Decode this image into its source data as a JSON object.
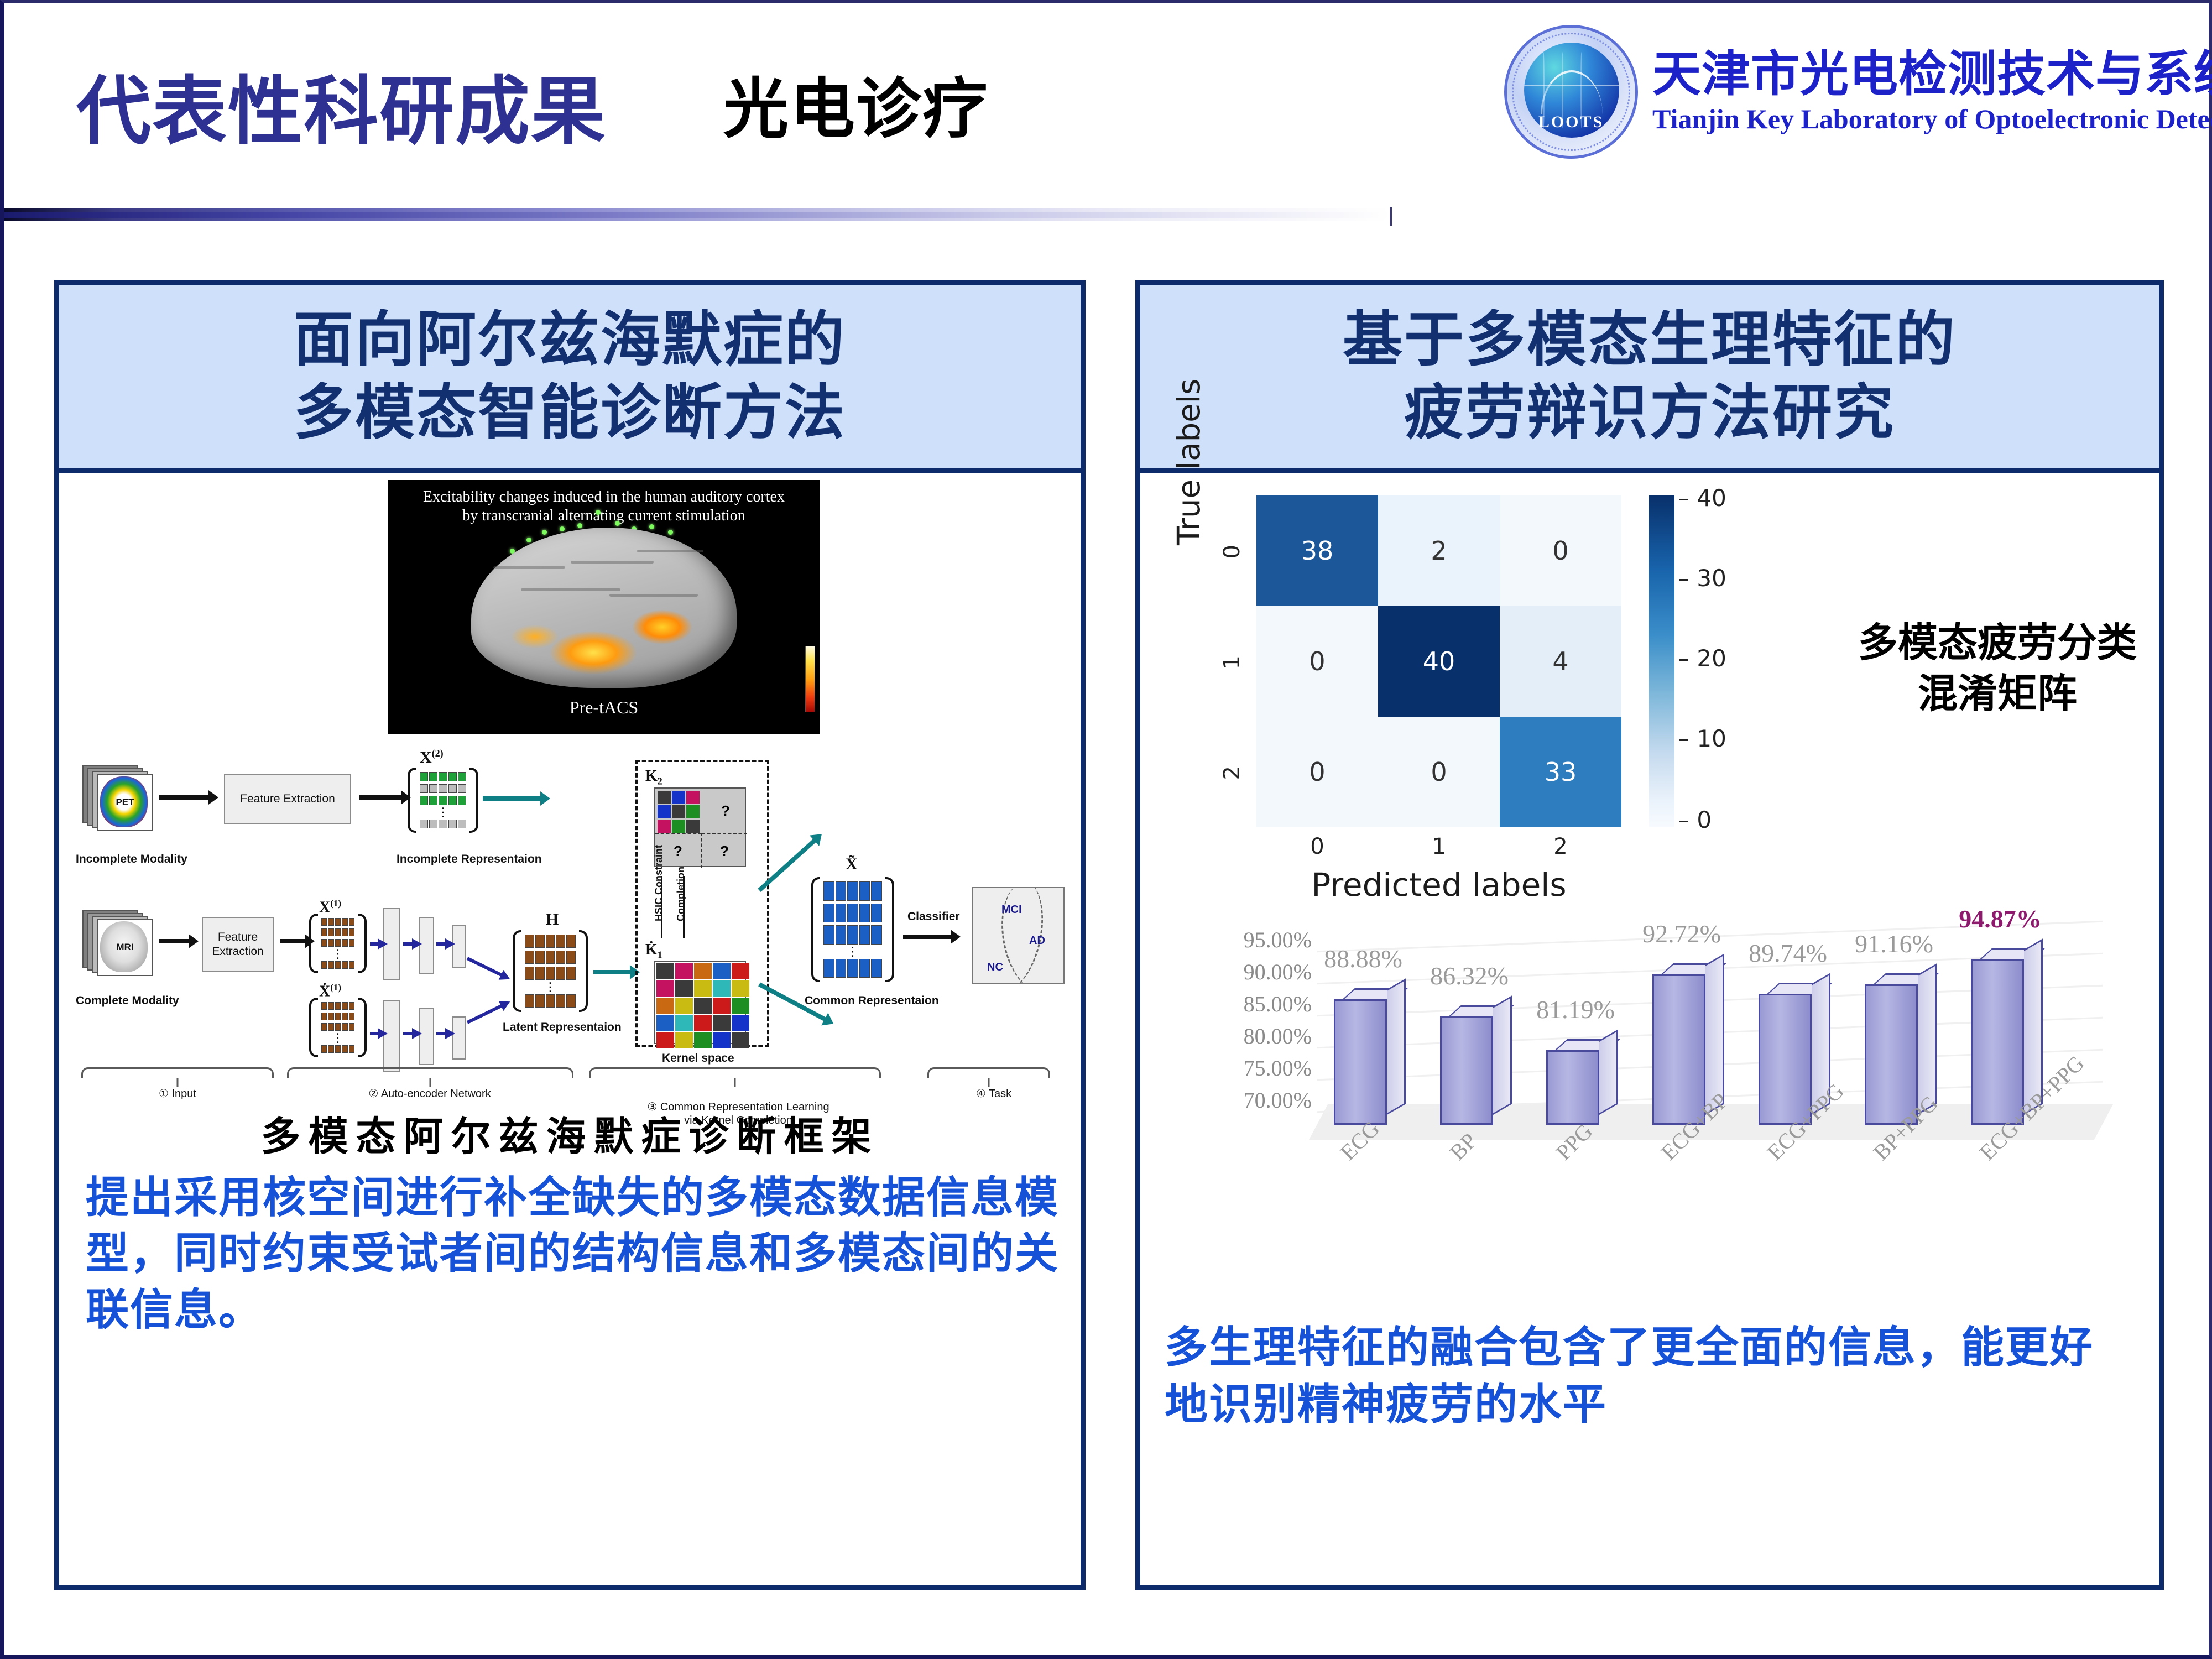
{
  "header": {
    "title": "代表性科研成果",
    "subtitle": "光电诊疗",
    "logo": {
      "badge_text": "LOOTS",
      "cn_name": "天津市光电检测技术与系统重点实验室",
      "en_name": "Tianjin Key Laboratory of Optoelectronic Detection and System"
    },
    "title_color": "#2e3192",
    "subtitle_color": "#000000",
    "logo_color": "#1d22c8"
  },
  "left_panel": {
    "title_line1": "面向阿尔兹海默症的",
    "title_line2": "多模态智能诊断方法",
    "brain_figure": {
      "caption_line1": "Excitability changes induced in the human auditory cortex",
      "caption_line2": "by transcranial alternating current stimulation",
      "label": "Pre-tACS"
    },
    "framework": {
      "incomplete_modality": "Incomplete Modality",
      "complete_modality": "Complete Modality",
      "feature_extraction_1": "Feature Extraction",
      "feature_extraction_2": "Feature Extraction",
      "pet_label": "PET",
      "mri_label": "MRI",
      "x2_symbol": "X",
      "x2_sup": "(2)",
      "x1_symbol": "X",
      "x1_sup": "(1)",
      "xdot_symbol": "Ẋ",
      "xdot_sup": "(1)",
      "h_symbol": "H",
      "xtilde_symbol": "X̃",
      "incomplete_representation": "Incomplete Representaion",
      "latent_representation": "Latent Representaion",
      "common_representation": "Common Representaion",
      "kernel_space": "Kernel space",
      "k2_symbol": "K",
      "k2_sub": "2",
      "k1_symbol": "K̇",
      "k1_sub": "1",
      "question_mark": "?",
      "hsic_constraint": "HSIC Constraint",
      "completion": "Completion",
      "classifier": "Classifier",
      "class_mci": "MCI",
      "class_ad": "AD",
      "class_nc": "NC",
      "stages": [
        {
          "num": "①",
          "label": "Input"
        },
        {
          "num": "②",
          "label": "Auto-encoder Network"
        },
        {
          "num": "③",
          "label": "Common Representation Learning\nvia Kernel Completion"
        },
        {
          "num": "④",
          "label": "Task"
        }
      ]
    },
    "framework_title": "多模态阿尔兹海默症诊断框架",
    "description": "提出采用核空间进行补全缺失的多模态数据信息模型，同时约束受试者间的结构信息和多模态间的关联信息。",
    "description_color": "#1652d8"
  },
  "right_panel": {
    "title_line1": "基于多模态生理特征的",
    "title_line2": "疲劳辩识方法研究",
    "note_line1": "多模态疲劳分类",
    "note_line2": "混淆矩阵",
    "description": "多生理特征的融合包含了更全面的信息，能更好地识别精神疲劳的水平",
    "description_color": "#1652d8"
  },
  "chart_data": [
    {
      "type": "heatmap",
      "title": "",
      "xlabel": "Predicted labels",
      "ylabel": "True labels",
      "xticks": [
        "0",
        "1",
        "2"
      ],
      "yticks": [
        "0",
        "1",
        "2"
      ],
      "matrix": [
        [
          38,
          2,
          0
        ],
        [
          0,
          40,
          4
        ],
        [
          0,
          0,
          33
        ]
      ],
      "colorbar": {
        "ticks": [
          0,
          10,
          20,
          30,
          40
        ],
        "vmin": 0,
        "vmax": 40,
        "cmap": "Blues"
      },
      "cell_colors": [
        [
          "#1b5799",
          "#eaf2fb",
          "#f3f8fd"
        ],
        [
          "#f3f8fd",
          "#08306b",
          "#e3eef9"
        ],
        [
          "#f3f8fd",
          "#f3f8fd",
          "#2d7dbf"
        ]
      ],
      "cell_text_colors": [
        [
          "#ffffff",
          "#333333",
          "#333333"
        ],
        [
          "#333333",
          "#ffffff",
          "#333333"
        ],
        [
          "#333333",
          "#333333",
          "#ffffff"
        ]
      ]
    },
    {
      "type": "bar",
      "title": "",
      "xlabel": "",
      "ylabel": "",
      "categories": [
        "ECG",
        "BP",
        "PPG",
        "ECG+BP",
        "ECG+PPG",
        "BP+PPG",
        "ECG+BP+PPG"
      ],
      "values": [
        88.88,
        86.32,
        81.19,
        92.72,
        89.74,
        91.16,
        94.87
      ],
      "value_labels": [
        "88.88%",
        "86.32%",
        "81.19%",
        "92.72%",
        "89.74%",
        "91.16%",
        "94.87%"
      ],
      "yticks": [
        "95.00%",
        "90.00%",
        "85.00%",
        "80.00%",
        "75.00%",
        "70.00%"
      ],
      "ylim": [
        70.0,
        95.0
      ],
      "highlight_index": 6,
      "bar_color": "#9a9ad4",
      "bar_edge_color": "#4a4a9c",
      "highlight_label_color": "#8e1a6e",
      "label_color": "#9a9a9a",
      "grid": true,
      "legend": "none"
    }
  ]
}
